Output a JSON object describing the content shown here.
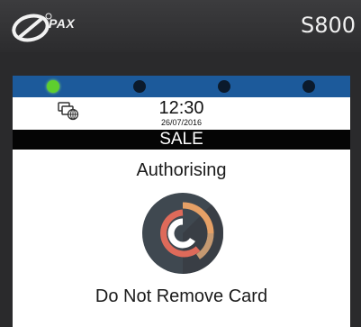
{
  "device": {
    "brand": "PAX",
    "model": "S800"
  },
  "leds": [
    {
      "name": "led-1",
      "on": true
    },
    {
      "name": "led-2",
      "on": false
    },
    {
      "name": "led-3",
      "on": false
    },
    {
      "name": "led-4",
      "on": false
    }
  ],
  "status": {
    "time": "12:30",
    "date": "26/07/2016",
    "network_icon": "network-icon"
  },
  "screen": {
    "title": "SALE",
    "status_text": "Authorising",
    "message": "Do Not Remove Card",
    "spinner_icon": "loading-spinner-icon"
  },
  "colors": {
    "led_bar": "#1c5a9b",
    "led_on": "#5ecf2e",
    "spinner_bg": "#3f4850",
    "spinner_outer": "#e6a066",
    "spinner_inner": "#de6a5a"
  }
}
